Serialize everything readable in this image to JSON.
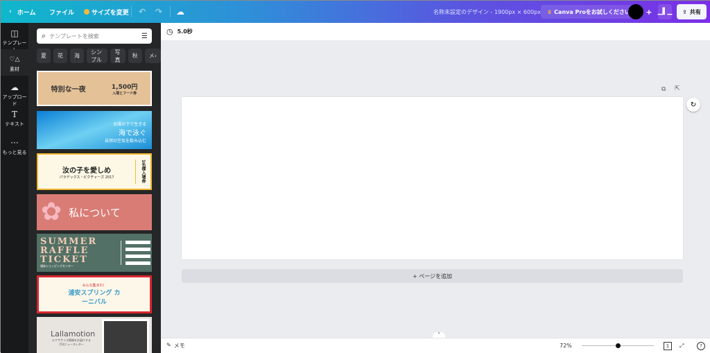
{
  "topbar": {
    "home": "ホーム",
    "file": "ファイル",
    "resize": "サイズを変更",
    "title": "名称未設定のデザイン - 1900px × 600px",
    "pro": "Canva Proをお試しください",
    "share": "共有"
  },
  "rail": [
    {
      "label": "テンプレート",
      "icon": "template-icon"
    },
    {
      "label": "素材",
      "icon": "elements-icon"
    },
    {
      "label": "アップロード",
      "icon": "upload-cloud-icon"
    },
    {
      "label": "テキスト",
      "icon": "text-icon"
    },
    {
      "label": "もっと見る",
      "icon": "more-icon"
    }
  ],
  "panel": {
    "search_placeholder": "テンプレートを検索",
    "chips": [
      "夏",
      "花",
      "海",
      "シンプル",
      "写真",
      "秋",
      "メ"
    ]
  },
  "thumbs": [
    {
      "title": "特別な一夜",
      "price": "1,500円",
      "sub": "入場とフード券"
    },
    {
      "line1": "太陽の下で生きる",
      "title": "海で泳ぐ",
      "line2": "自然の空気を飲み込む"
    },
    {
      "title": "汝の子を愛しめ",
      "sub": "パラデックス・ピクチャーズ 2017",
      "side": "1名様入場券"
    },
    {
      "title": "私について"
    },
    {
      "title": "SUMMER RAFFLE TICKET",
      "sub": "浦安ショッピングセンター"
    },
    {
      "top": "みんな集まれ！",
      "title": "浦安スプリング カーニバル"
    },
    {
      "title": "Lallamotion",
      "sub": "エクササイズ情報をお届けする 月刊ニュースレター"
    }
  ],
  "toolbar": {
    "duration": "5.0秒"
  },
  "canvas": {
    "add_page": "+ ページを追加"
  },
  "bottombar": {
    "notes": "メモ",
    "zoom": "72%",
    "zoom_level": 0.5,
    "page_count": "1"
  }
}
